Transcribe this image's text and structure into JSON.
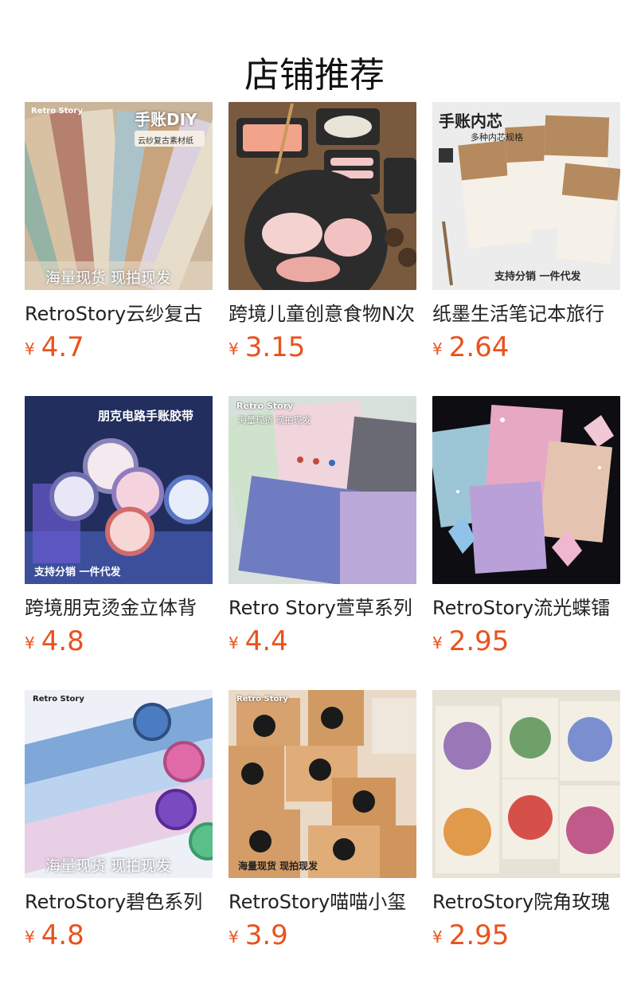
{
  "page": {
    "title": "店铺推荐"
  },
  "products": [
    {
      "name": "RetroStory云纱复古",
      "currency": "¥",
      "price": "4.7",
      "image_texts": [
        "Retro Story",
        "手账DIY",
        "云纱复古素材纸",
        "海量现货 现拍现发"
      ]
    },
    {
      "name": "跨境儿童创意食物N次",
      "currency": "¥",
      "price": "3.15",
      "image_texts": []
    },
    {
      "name": "纸墨生活笔记本旅行",
      "currency": "¥",
      "price": "2.64",
      "image_texts": [
        "手账内芯",
        "多种内芯规格",
        "支持分销 一件代发"
      ]
    },
    {
      "name": "跨境朋克烫金立体背",
      "currency": "¥",
      "price": "4.8",
      "image_texts": [
        "朋克电路手账胶带",
        "支持分销 一件代发"
      ]
    },
    {
      "name": "Retro Story萱草系列",
      "currency": "¥",
      "price": "4.4",
      "image_texts": [
        "Retro Story",
        "海量现货 现拍现发"
      ]
    },
    {
      "name": "RetroStory流光蝶镭",
      "currency": "¥",
      "price": "2.95",
      "image_texts": []
    },
    {
      "name": "RetroStory碧色系列",
      "currency": "¥",
      "price": "4.8",
      "image_texts": [
        "Retro Story",
        "海量现货 现拍现发"
      ]
    },
    {
      "name": "RetroStory喵喵小玺",
      "currency": "¥",
      "price": "3.9",
      "image_texts": [
        "Retro Story",
        "海量现货 现拍现发"
      ]
    },
    {
      "name": "RetroStory院角玫瑰",
      "currency": "¥",
      "price": "2.95",
      "image_texts": []
    }
  ],
  "colors": {
    "price": "#e8531e",
    "title": "#111111",
    "name": "#222222"
  }
}
